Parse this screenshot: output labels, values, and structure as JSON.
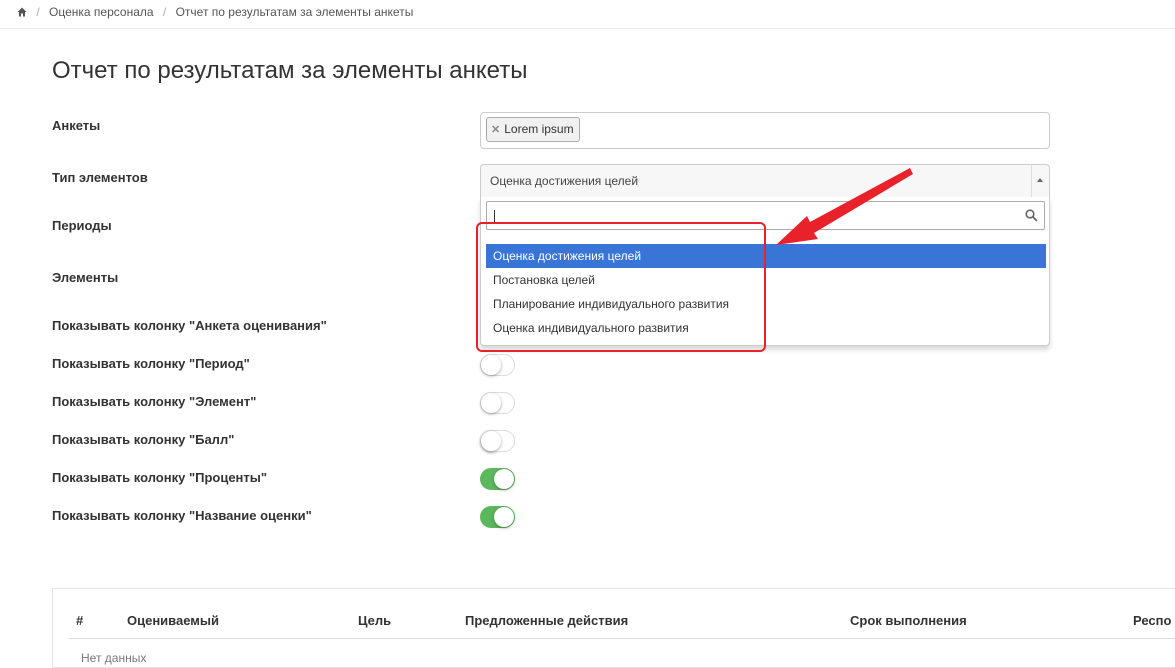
{
  "breadcrumb": {
    "items": [
      "Оценка персонала",
      "Отчет по результатам за элементы анкеты"
    ]
  },
  "page": {
    "title": "Отчет по результатам за элементы анкеты"
  },
  "form": {
    "questionnaires": {
      "label": "Анкеты",
      "chips": [
        "Lorem ipsum"
      ]
    },
    "element_type": {
      "label": "Тип элементов",
      "selected": "Оценка достижения целей",
      "search_value": "",
      "options": [
        "Оценка достижения целей",
        "Постановка целей",
        "Планирование индивидуального развития",
        "Оценка индивидуального развития"
      ],
      "active_option": "Оценка достижения целей"
    },
    "periods": {
      "label": "Периоды"
    },
    "elements": {
      "label": "Элементы"
    },
    "toggles": [
      {
        "label": "Показывать колонку \"Анкета оценивания\"",
        "on": false
      },
      {
        "label": "Показывать колонку \"Период\"",
        "on": false
      },
      {
        "label": "Показывать колонку \"Элемент\"",
        "on": false
      },
      {
        "label": "Показывать колонку \"Балл\"",
        "on": false
      },
      {
        "label": "Показывать колонку \"Проценты\"",
        "on": true
      },
      {
        "label": "Показывать колонку \"Название оценки\"",
        "on": true
      }
    ]
  },
  "table": {
    "columns": [
      "#",
      "Оцениваемый",
      "Цель",
      "Предложенные действия",
      "Срок выполнения",
      "Респо"
    ],
    "empty_text": "Нет данных"
  },
  "colors": {
    "accent": "#3875d7",
    "toggle_on": "#5cb85c",
    "highlight": "#e8212a"
  },
  "icons": [
    "home-icon",
    "search-icon",
    "remove-icon",
    "caret-up-icon",
    "arrow-annotation"
  ]
}
